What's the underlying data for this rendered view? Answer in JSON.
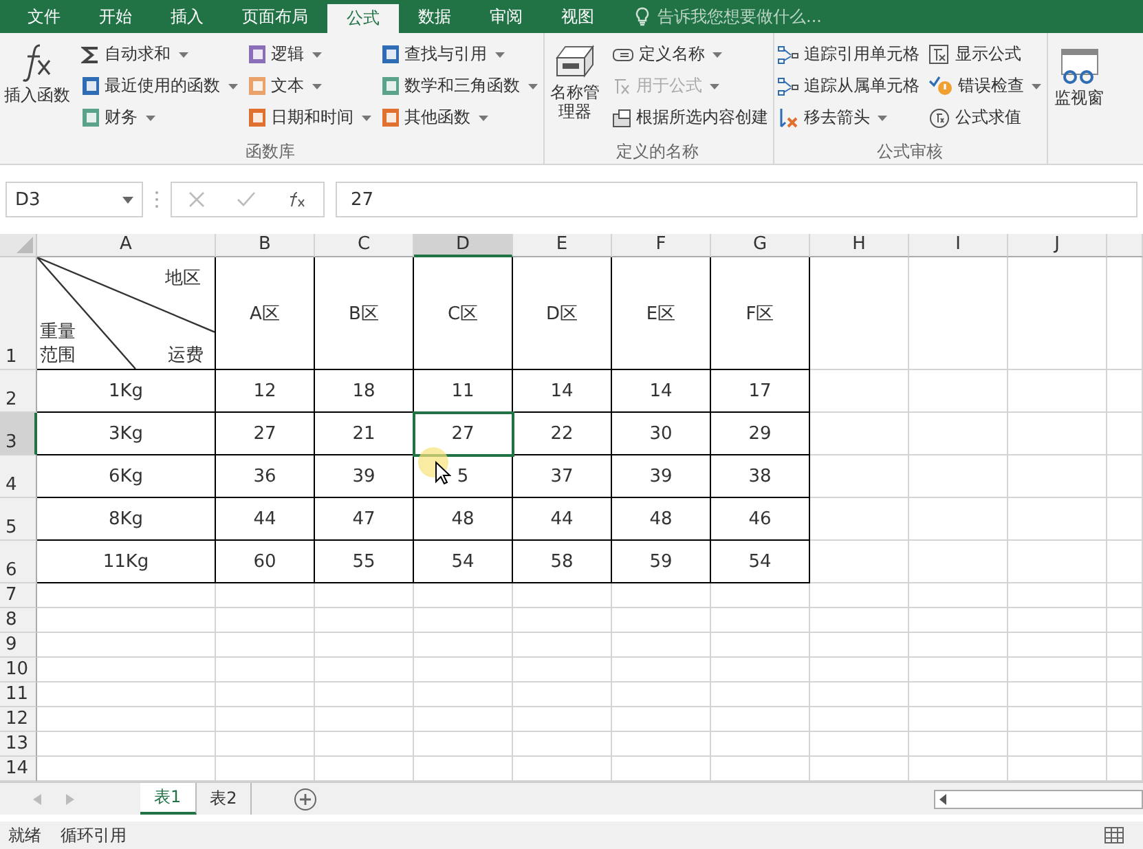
{
  "tabs": [
    {
      "label": "文件",
      "selected": false
    },
    {
      "label": "开始",
      "selected": false
    },
    {
      "label": "插入",
      "selected": false
    },
    {
      "label": "页面布局",
      "selected": false
    },
    {
      "label": "公式",
      "selected": true
    },
    {
      "label": "数据",
      "selected": false
    },
    {
      "label": "审阅",
      "selected": false
    },
    {
      "label": "视图",
      "selected": false
    }
  ],
  "tell_me": {
    "placeholder": "告诉我您想要做什么..."
  },
  "ribbon": {
    "groups": [
      {
        "label": "函数库",
        "big": {
          "label": "插入函数",
          "kind": "fx"
        },
        "columns": [
          [
            {
              "label": "自动求和",
              "kind": "sum",
              "dropdown": true,
              "disabled": false
            },
            {
              "label": "最近使用的函数",
              "kind": "recent",
              "dropdown": true,
              "disabled": false
            },
            {
              "label": "财务",
              "kind": "finance",
              "dropdown": true,
              "disabled": false
            }
          ],
          [
            {
              "label": "逻辑",
              "kind": "logic",
              "dropdown": true,
              "disabled": false
            },
            {
              "label": "文本",
              "kind": "text",
              "dropdown": true,
              "disabled": false
            },
            {
              "label": "日期和时间",
              "kind": "datetime",
              "dropdown": true,
              "disabled": false
            }
          ],
          [
            {
              "label": "查找与引用",
              "kind": "lookup",
              "dropdown": true,
              "disabled": false
            },
            {
              "label": "数学和三角函数",
              "kind": "math",
              "dropdown": true,
              "disabled": false
            },
            {
              "label": "其他函数",
              "kind": "more",
              "dropdown": true,
              "disabled": false
            }
          ]
        ]
      },
      {
        "label": "定义的名称",
        "big": {
          "label": "名称管理器",
          "kind": "manager"
        },
        "columns": [
          [
            {
              "label": "定义名称",
              "kind": "tag",
              "dropdown": true,
              "disabled": false
            },
            {
              "label": "用于公式",
              "kind": "formula",
              "dropdown": true,
              "disabled": true
            },
            {
              "label": "根据所选内容创建",
              "kind": "create",
              "dropdown": false,
              "disabled": false
            }
          ]
        ]
      },
      {
        "label": "公式审核",
        "columns": [
          [
            {
              "label": "追踪引用单元格",
              "kind": "precedents",
              "dropdown": false,
              "disabled": false
            },
            {
              "label": "追踪从属单元格",
              "kind": "dependents",
              "dropdown": false,
              "disabled": false
            },
            {
              "label": "移去箭头",
              "kind": "remove",
              "dropdown": true,
              "disabled": false
            }
          ],
          [
            {
              "label": "显示公式",
              "kind": "show",
              "dropdown": false,
              "disabled": false
            },
            {
              "label": "错误检查",
              "kind": "error",
              "dropdown": true,
              "disabled": false
            },
            {
              "label": "公式求值",
              "kind": "evaluate",
              "dropdown": false,
              "disabled": false
            }
          ]
        ]
      }
    ],
    "watch": {
      "label": "监视窗"
    }
  },
  "name_box": "D3",
  "formula": "27",
  "columns": [
    {
      "label": "A",
      "selected": false
    },
    {
      "label": "B",
      "selected": false
    },
    {
      "label": "C",
      "selected": false
    },
    {
      "label": "D",
      "selected": true
    },
    {
      "label": "E",
      "selected": false
    },
    {
      "label": "F",
      "selected": false
    },
    {
      "label": "G",
      "selected": false
    },
    {
      "label": "H",
      "selected": false
    },
    {
      "label": "I",
      "selected": false
    },
    {
      "label": "J",
      "selected": false
    }
  ],
  "corner_cell": {
    "top_right": "地区",
    "bottom_left": "重量范围",
    "bottom_right": "运费"
  },
  "rows": [
    {
      "header": "1",
      "selected": false,
      "cells": [
        "A区",
        "B区",
        "C区",
        "D区",
        "E区",
        "F区"
      ]
    },
    {
      "header": "2",
      "selected": false,
      "cells": [
        "1Kg",
        "12",
        "18",
        "11",
        "14",
        "14",
        "17"
      ]
    },
    {
      "header": "3",
      "selected": true,
      "cells": [
        "3Kg",
        "27",
        "21",
        "27",
        "22",
        "30",
        "29"
      ]
    },
    {
      "header": "4",
      "selected": false,
      "cells": [
        "6Kg",
        "36",
        "39",
        "5",
        "37",
        "39",
        "38"
      ]
    },
    {
      "header": "5",
      "selected": false,
      "cells": [
        "8Kg",
        "44",
        "47",
        "48",
        "44",
        "48",
        "46"
      ]
    },
    {
      "header": "6",
      "selected": false,
      "cells": [
        "11Kg",
        "60",
        "55",
        "54",
        "58",
        "59",
        "54"
      ]
    },
    {
      "header": "7",
      "selected": false,
      "cells": []
    },
    {
      "header": "8",
      "selected": false,
      "cells": []
    },
    {
      "header": "9",
      "selected": false,
      "cells": []
    },
    {
      "header": "10",
      "selected": false,
      "cells": []
    },
    {
      "header": "11",
      "selected": false,
      "cells": []
    },
    {
      "header": "12",
      "selected": false,
      "cells": []
    },
    {
      "header": "13",
      "selected": false,
      "cells": []
    },
    {
      "header": "14",
      "selected": false,
      "cells": []
    }
  ],
  "sheets": [
    {
      "label": "表1",
      "selected": true
    },
    {
      "label": "表2",
      "selected": false
    }
  ],
  "status": [
    "就绪",
    "循环引用"
  ]
}
